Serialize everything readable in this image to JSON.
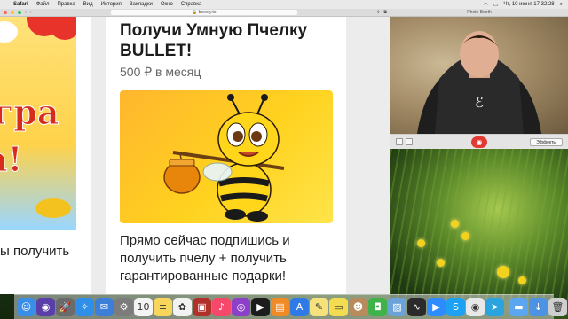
{
  "menubar": {
    "app": "Safari",
    "items": [
      "Файл",
      "Правка",
      "Вид",
      "История",
      "Закладки",
      "Окно",
      "Справка"
    ],
    "clock": "Чт, 10 июня  17:32:28"
  },
  "safari": {
    "url": "boosty.to"
  },
  "left_card": {
    "banner_text_1": "гра",
    "banner_text_2": "а!",
    "caption": "ы получить"
  },
  "main_card": {
    "title": "Получи Умную Пчелку BULLET!",
    "price": "500 ₽ в месяц",
    "description": "Прямо сейчас подпишись и получить пчелу + получить гарантированные подарки!"
  },
  "photobooth": {
    "window_title": "Photo Booth",
    "effects_label": "Эффекты",
    "shutter_icon": "camera-icon"
  },
  "dock": {
    "icons": [
      {
        "name": "finder-icon",
        "color": "#3a8ee6",
        "glyph": "☺"
      },
      {
        "name": "siri-icon",
        "color": "#5b3fa8",
        "glyph": "◉"
      },
      {
        "name": "launchpad-icon",
        "color": "#6b6b6b",
        "glyph": "🚀"
      },
      {
        "name": "safari-icon",
        "color": "#2f8ee8",
        "glyph": "✧"
      },
      {
        "name": "mail-icon",
        "color": "#3c7fd9",
        "glyph": "✉"
      },
      {
        "name": "preferences-icon",
        "color": "#7c7c7c",
        "glyph": "⚙"
      },
      {
        "name": "calendar-icon",
        "color": "#f4f4f4",
        "glyph": "10"
      },
      {
        "name": "notes-icon",
        "color": "#f7d65b",
        "glyph": "≡"
      },
      {
        "name": "photos-icon",
        "color": "#f2f2f2",
        "glyph": "✿"
      },
      {
        "name": "photo-booth-icon",
        "color": "#b2302a",
        "glyph": "▣"
      },
      {
        "name": "music-icon",
        "color": "#f5486a",
        "glyph": "♪"
      },
      {
        "name": "podcasts-icon",
        "color": "#8c3fc9",
        "glyph": "◎"
      },
      {
        "name": "tv-icon",
        "color": "#1c1c1c",
        "glyph": "▶"
      },
      {
        "name": "books-icon",
        "color": "#f08a24",
        "glyph": "▤"
      },
      {
        "name": "appstore-icon",
        "color": "#2e7ae6",
        "glyph": "A"
      },
      {
        "name": "notes-app-icon",
        "color": "#f5e27c",
        "glyph": "✎"
      },
      {
        "name": "stickies-icon",
        "color": "#f3dc4f",
        "glyph": "▭"
      },
      {
        "name": "contacts-icon",
        "color": "#b98a5c",
        "glyph": "☻"
      },
      {
        "name": "facetime-icon",
        "color": "#3fb24a",
        "glyph": "◘"
      },
      {
        "name": "preview-icon",
        "color": "#6aa2d9",
        "glyph": "▨"
      },
      {
        "name": "activity-icon",
        "color": "#2b2b2b",
        "glyph": "∿"
      },
      {
        "name": "zoom-icon",
        "color": "#2d8cff",
        "glyph": "▶"
      },
      {
        "name": "skype-icon",
        "color": "#1da1f2",
        "glyph": "S"
      },
      {
        "name": "chrome-icon",
        "color": "#e8e8e8",
        "glyph": "◉"
      },
      {
        "name": "telegram-icon",
        "color": "#2aa3df",
        "glyph": "➤"
      },
      {
        "name": "finder-folder-icon",
        "color": "#5aa6f0",
        "glyph": "▬"
      },
      {
        "name": "downloads-icon",
        "color": "#4d93e3",
        "glyph": "↓"
      },
      {
        "name": "trash-icon",
        "color": "#cfcfcf",
        "glyph": "🗑"
      }
    ]
  }
}
